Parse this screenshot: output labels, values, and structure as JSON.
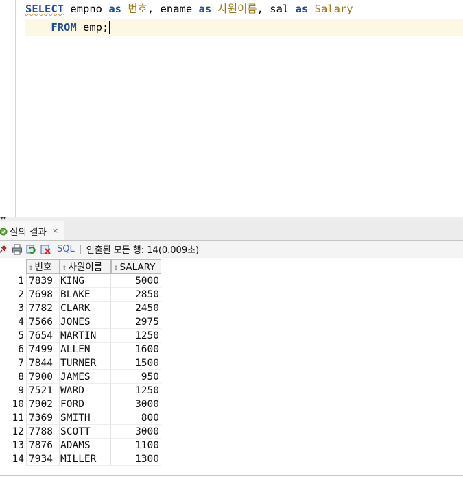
{
  "editor": {
    "line1": {
      "kw_select": "SELECT",
      "t1": " empno ",
      "kw_as1": "as",
      "sp1": " ",
      "alias1": "번호",
      "t2": ", ename ",
      "kw_as2": "as",
      "sp2": " ",
      "alias2": "사원이름",
      "t3": ", sal ",
      "kw_as3": "as",
      "sp3": " ",
      "alias3": "Salary"
    },
    "line2": {
      "indent": "    ",
      "kw_from": "FROM",
      "t1": " emp;"
    }
  },
  "results_tab": {
    "label": "질의 결과",
    "close": "×"
  },
  "toolbar": {
    "sql_label": "SQL",
    "status": "인출된 모든 행: 14(0.009초)"
  },
  "grid": {
    "columns": [
      "번호",
      "사원이름",
      "SALARY"
    ],
    "rows": [
      {
        "n": "1",
        "empno": "7839",
        "ename": "KING",
        "sal": "5000"
      },
      {
        "n": "2",
        "empno": "7698",
        "ename": "BLAKE",
        "sal": "2850"
      },
      {
        "n": "3",
        "empno": "7782",
        "ename": "CLARK",
        "sal": "2450"
      },
      {
        "n": "4",
        "empno": "7566",
        "ename": "JONES",
        "sal": "2975"
      },
      {
        "n": "5",
        "empno": "7654",
        "ename": "MARTIN",
        "sal": "1250"
      },
      {
        "n": "6",
        "empno": "7499",
        "ename": "ALLEN",
        "sal": "1600"
      },
      {
        "n": "7",
        "empno": "7844",
        "ename": "TURNER",
        "sal": "1500"
      },
      {
        "n": "8",
        "empno": "7900",
        "ename": "JAMES",
        "sal": "950"
      },
      {
        "n": "9",
        "empno": "7521",
        "ename": "WARD",
        "sal": "1250"
      },
      {
        "n": "10",
        "empno": "7902",
        "ename": "FORD",
        "sal": "3000"
      },
      {
        "n": "11",
        "empno": "7369",
        "ename": "SMITH",
        "sal": "800"
      },
      {
        "n": "12",
        "empno": "7788",
        "ename": "SCOTT",
        "sal": "3000"
      },
      {
        "n": "13",
        "empno": "7876",
        "ename": "ADAMS",
        "sal": "1100"
      },
      {
        "n": "14",
        "empno": "7934",
        "ename": "MILLER",
        "sal": "1300"
      }
    ]
  },
  "colors": {
    "keyword": "#1f4d9c",
    "alias": "#9c7a18",
    "current_line": "#fdf8e3",
    "sql_link": "#3a63b4"
  },
  "icons": [
    "query-result-icon",
    "pin-icon",
    "print-icon",
    "refresh-icon",
    "clear-icon",
    "sort-icon"
  ]
}
